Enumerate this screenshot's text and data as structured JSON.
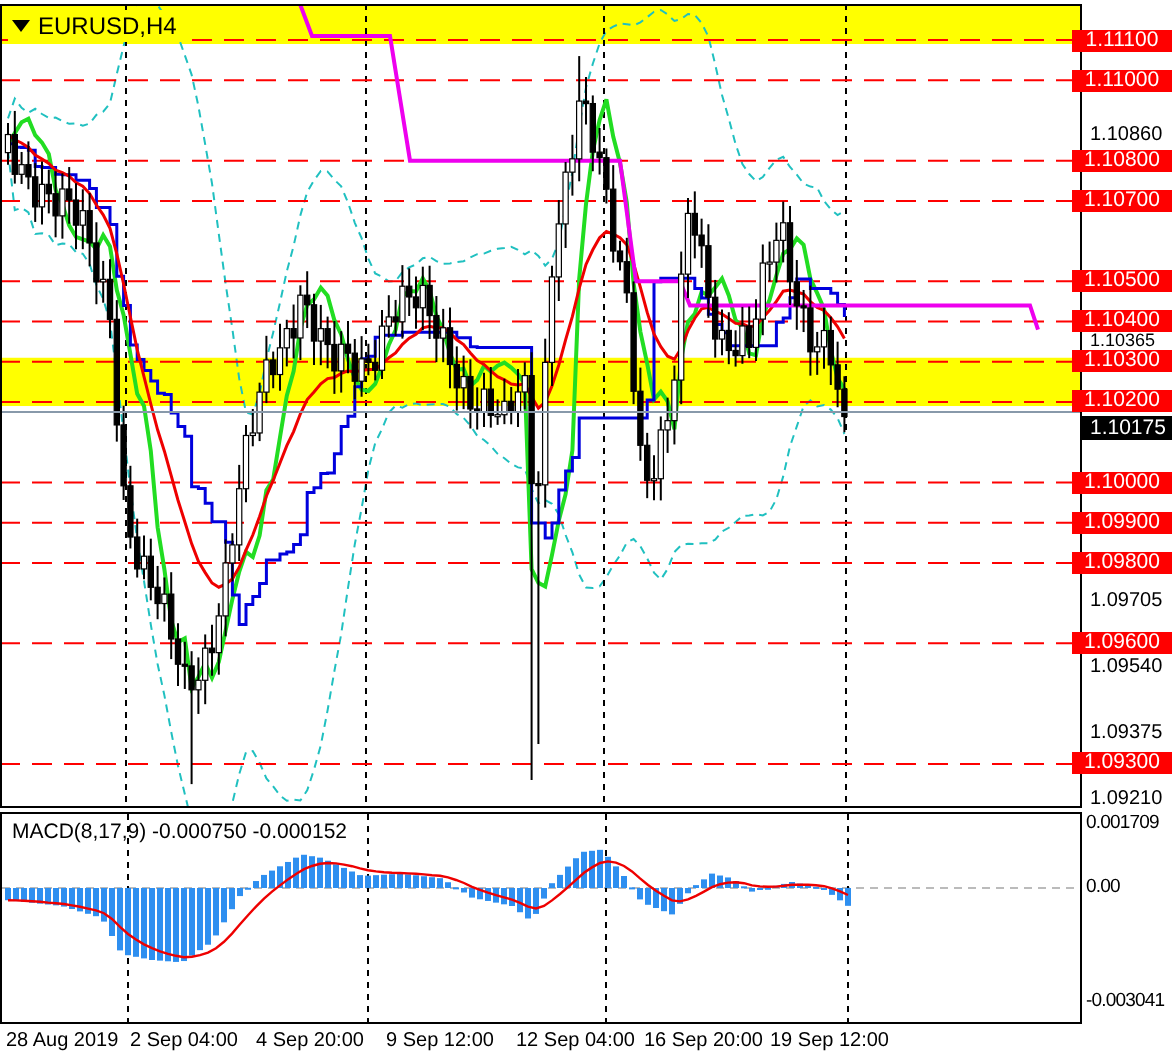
{
  "symbol": {
    "label": "EURUSD,H4"
  },
  "price_axis": {
    "ticks": [
      "1.10860",
      "1.10365",
      "1.09705",
      "1.09540",
      "1.09375",
      "1.09210"
    ]
  },
  "levels": [
    {
      "label": "1.11100"
    },
    {
      "label": "1.11000"
    },
    {
      "label": "1.10800"
    },
    {
      "label": "1.10700"
    },
    {
      "label": "1.10500"
    },
    {
      "label": "1.10400"
    },
    {
      "label": "1.10300"
    },
    {
      "label": "1.10200"
    },
    {
      "label": "1.10000"
    },
    {
      "label": "1.09900"
    },
    {
      "label": "1.09800"
    },
    {
      "label": "1.09600"
    },
    {
      "label": "1.09300"
    }
  ],
  "current_price": {
    "label": "1.10175"
  },
  "macd": {
    "legend": "MACD(8,17,9) -0.000750 -0.000152",
    "axis_ticks": [
      "0.001709",
      "0.00",
      "-0.003041"
    ]
  },
  "time_axis": {
    "labels": [
      "28 Aug 2019",
      "2 Sep 04:00",
      "4 Sep 20:00",
      "9 Sep 12:00",
      "12 Sep 04:00",
      "16 Sep 20:00",
      "19 Sep 12:00"
    ]
  }
}
